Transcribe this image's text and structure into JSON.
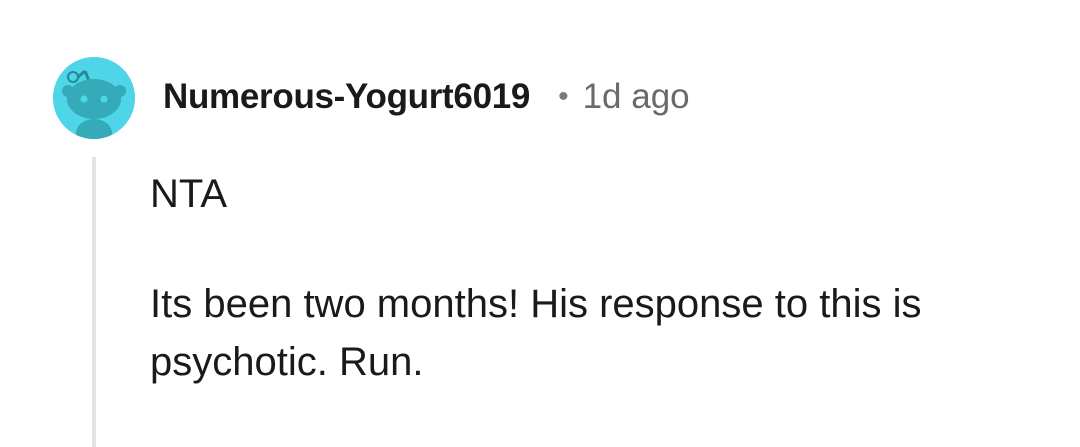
{
  "comment": {
    "author": "Numerous-Yogurt6019",
    "separator": "•",
    "age": "1d ago",
    "avatar_icon": "snoo-avatar-icon",
    "avatar_color": "#4fd5e8",
    "paragraphs": [
      "NTA",
      "Its been two months! His response to this is psychotic. Run."
    ]
  }
}
